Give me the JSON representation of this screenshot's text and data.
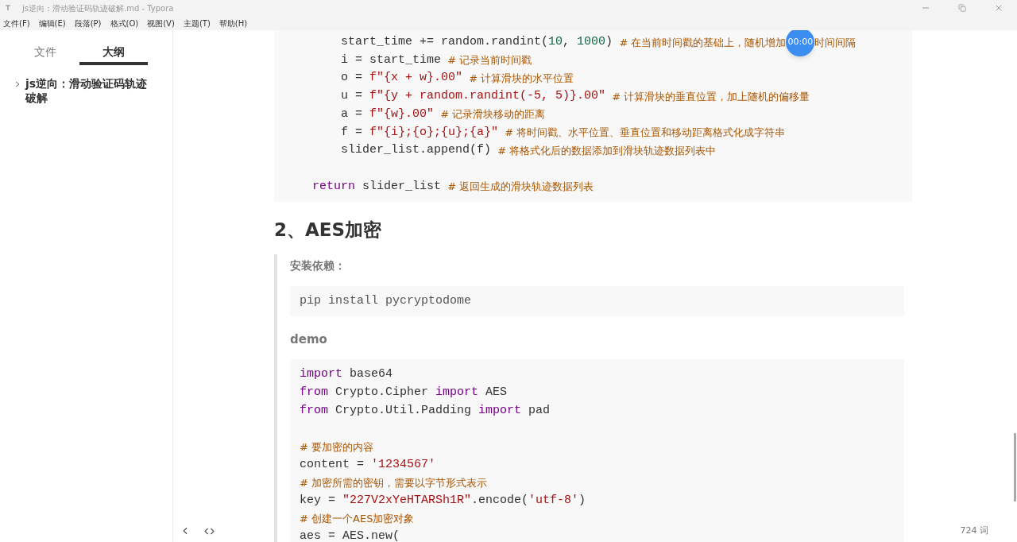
{
  "window": {
    "title": "js逆向：滑动验证码轨迹破解.md - Typora"
  },
  "menu": [
    "文件(F)",
    "编辑(E)",
    "段落(P)",
    "格式(O)",
    "视图(V)",
    "主题(T)",
    "帮助(H)"
  ],
  "sidebar": {
    "tabs": [
      {
        "label": "文件",
        "selected": false
      },
      {
        "label": "大纲",
        "selected": true
      }
    ],
    "outline": [
      {
        "label": "js逆向：滑动验证码轨迹破解",
        "expanded": false
      }
    ]
  },
  "timer": {
    "label": "00:00"
  },
  "code_block_1": [
    {
      "kind": "code",
      "tokens": [
        {
          "kind": "plain",
          "t": "        start_time += random.randint("
        },
        {
          "kind": "number",
          "t": "10"
        },
        {
          "kind": "plain",
          "t": ", "
        },
        {
          "kind": "number",
          "t": "1000"
        },
        {
          "kind": "plain",
          "t": ")"
        },
        {
          "kind": "comment",
          "t": "  # 在当前时间戳的基础上，随机增加"
        },
        {
          "kind": "timer"
        },
        {
          "kind": "comment",
          "t": "时间间隔"
        }
      ]
    },
    {
      "kind": "code",
      "tokens": [
        {
          "kind": "plain",
          "t": "        i = start_time"
        },
        {
          "kind": "comment",
          "t": "  # 记录当前时间戳"
        }
      ]
    },
    {
      "kind": "code",
      "tokens": [
        {
          "kind": "plain",
          "t": "        o = "
        },
        {
          "kind": "string",
          "t": "f\"{x + w}.00\""
        },
        {
          "kind": "comment",
          "t": "  # 计算滑块的水平位置"
        }
      ]
    },
    {
      "kind": "code",
      "tokens": [
        {
          "kind": "plain",
          "t": "        u = "
        },
        {
          "kind": "string",
          "t": "f\"{y + random.randint(-5, 5)}.00\""
        },
        {
          "kind": "comment",
          "t": "  # 计算滑块的垂直位置，加上随机的偏移量"
        }
      ]
    },
    {
      "kind": "code",
      "tokens": [
        {
          "kind": "plain",
          "t": "        a = "
        },
        {
          "kind": "string",
          "t": "f\"{w}.00\""
        },
        {
          "kind": "comment",
          "t": "  # 记录滑块移动的距离"
        }
      ]
    },
    {
      "kind": "code",
      "tokens": [
        {
          "kind": "plain",
          "t": "        f = "
        },
        {
          "kind": "string",
          "t": "f\"{i};{o};{u};{a}\""
        },
        {
          "kind": "comment",
          "t": "  # 将时间戳、水平位置、垂直位置和移动距离格式化成字符串"
        }
      ]
    },
    {
      "kind": "code",
      "tokens": [
        {
          "kind": "plain",
          "t": "        slider_list.append(f)"
        },
        {
          "kind": "comment",
          "t": "  # 将格式化后的数据添加到滑块轨迹数据列表中"
        }
      ]
    },
    {
      "kind": "blank"
    },
    {
      "kind": "code",
      "tokens": [
        {
          "kind": "keyword",
          "t": "    return"
        },
        {
          "kind": "plain",
          "t": " slider_list"
        },
        {
          "kind": "comment",
          "t": "  # 返回生成的滑块轨迹数据列表"
        }
      ]
    }
  ],
  "heading": "2、AES加密",
  "quote": {
    "install_label": "安装依赖：",
    "install_cmd": "pip install pycryptodome",
    "demo_label": "demo",
    "code": [
      {
        "kind": "code",
        "tokens": [
          {
            "kind": "keyword",
            "t": "import"
          },
          {
            "kind": "plain",
            "t": " base64"
          }
        ]
      },
      {
        "kind": "code",
        "tokens": [
          {
            "kind": "keyword",
            "t": "from"
          },
          {
            "kind": "plain",
            "t": " Crypto.Cipher "
          },
          {
            "kind": "keyword",
            "t": "import"
          },
          {
            "kind": "plain",
            "t": " AES"
          }
        ]
      },
      {
        "kind": "code",
        "tokens": [
          {
            "kind": "keyword",
            "t": "from"
          },
          {
            "kind": "plain",
            "t": " Crypto.Util.Padding "
          },
          {
            "kind": "keyword",
            "t": "import"
          },
          {
            "kind": "plain",
            "t": " pad"
          }
        ]
      },
      {
        "kind": "blank"
      },
      {
        "kind": "code",
        "tokens": [
          {
            "kind": "comment",
            "t": "# 要加密的内容"
          }
        ]
      },
      {
        "kind": "code",
        "tokens": [
          {
            "kind": "plain",
            "t": "content = "
          },
          {
            "kind": "string",
            "t": "'1234567'"
          }
        ]
      },
      {
        "kind": "code",
        "tokens": [
          {
            "kind": "comment",
            "t": "# 加密所需的密钥，需要以字节形式表示"
          }
        ]
      },
      {
        "kind": "code",
        "tokens": [
          {
            "kind": "plain",
            "t": "key = "
          },
          {
            "kind": "string",
            "t": "\"227V2xYeHTARSh1R\""
          },
          {
            "kind": "plain",
            "t": ".encode("
          },
          {
            "kind": "string",
            "t": "'utf-8'"
          },
          {
            "kind": "plain",
            "t": ")"
          }
        ]
      },
      {
        "kind": "code",
        "tokens": [
          {
            "kind": "comment",
            "t": "# 创建一个AES加密对象"
          }
        ]
      },
      {
        "kind": "code",
        "tokens": [
          {
            "kind": "plain",
            "t": "aes = AES.new("
          }
        ]
      }
    ]
  },
  "footer": {
    "word_count": "724 词"
  }
}
